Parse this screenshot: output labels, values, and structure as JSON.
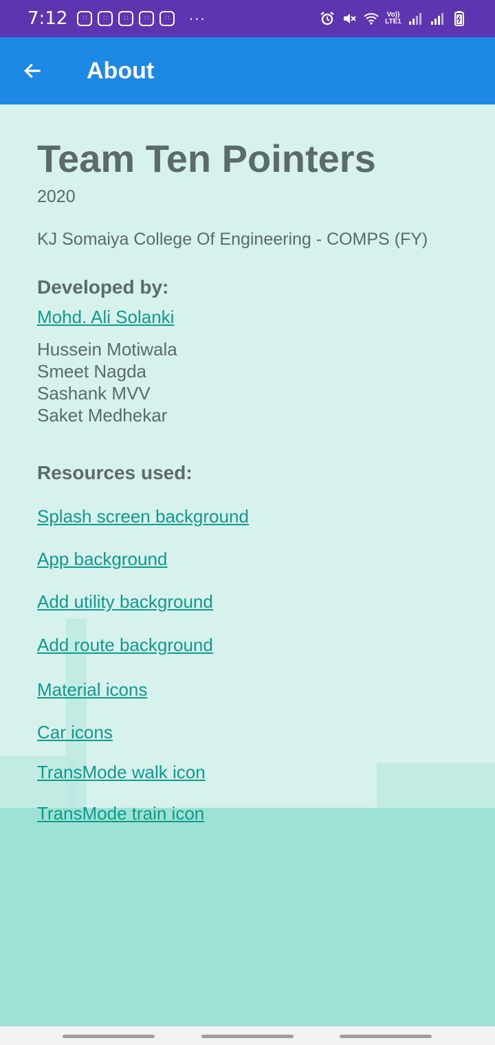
{
  "status_bar": {
    "time": "7:12",
    "more": "···",
    "network_label": "Vo)) LTE1"
  },
  "app_bar": {
    "title": "About"
  },
  "about": {
    "team_name": "Team Ten Pointers",
    "year": "2020",
    "college": "KJ Somaiya College Of Engineering - COMPS (FY)",
    "developed_by_heading": "Developed by:",
    "lead_developer": "Mohd. Ali Solanki",
    "developers": [
      "Hussein Motiwala",
      "Smeet Nagda",
      "Sashank MVV",
      "Saket Medhekar"
    ],
    "resources_heading": "Resources used:",
    "resources": [
      "Splash screen background",
      "App background",
      "Add utility background",
      "Add route background",
      "Material icons",
      "Car icons",
      "TransMode walk icon",
      "TransMode train icon"
    ]
  },
  "colors": {
    "status_bar": "#5d35b1",
    "app_bar": "#1e88e5",
    "link": "#109a8c",
    "text": "#5b6b67",
    "background": "#d7f1ec",
    "ground": "#9ee2d5"
  }
}
